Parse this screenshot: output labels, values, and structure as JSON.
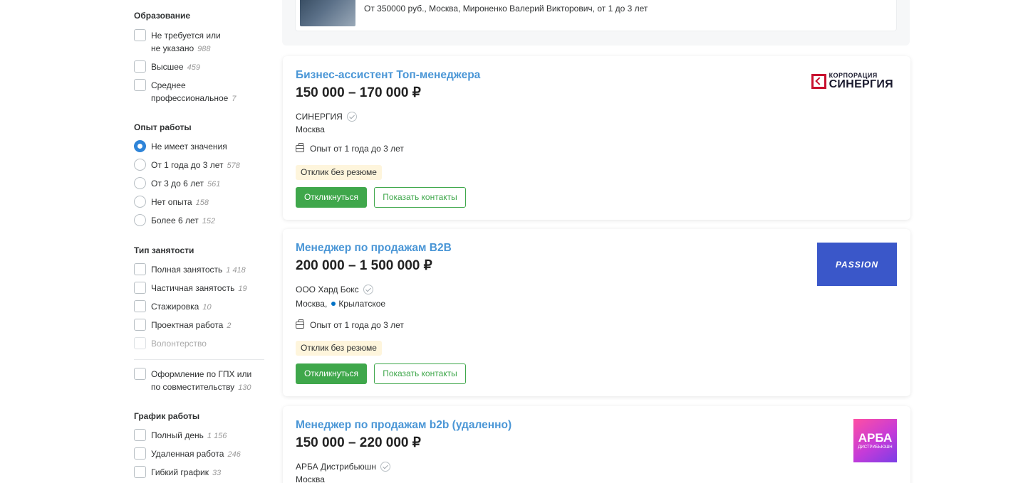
{
  "filters": {
    "education": {
      "title": "Образование",
      "options": [
        {
          "label_line1": "Не требуется или",
          "label_line2": "не указано",
          "count": "988"
        },
        {
          "label": "Высшее",
          "count": "459"
        },
        {
          "label_line1": "Среднее",
          "label_line2": "профессиональное",
          "count": "7"
        }
      ]
    },
    "experience": {
      "title": "Опыт работы",
      "options": [
        {
          "label": "Не имеет значения",
          "count": "",
          "selected": true
        },
        {
          "label": "От 1 года до 3 лет",
          "count": "578"
        },
        {
          "label": "От 3 до 6 лет",
          "count": "561"
        },
        {
          "label": "Нет опыта",
          "count": "158"
        },
        {
          "label": "Более 6 лет",
          "count": "152"
        }
      ]
    },
    "employment": {
      "title": "Тип занятости",
      "options": [
        {
          "label": "Полная занятость",
          "count": "1 418"
        },
        {
          "label": "Частичная занятость",
          "count": "19"
        },
        {
          "label": "Стажировка",
          "count": "10"
        },
        {
          "label": "Проектная работа",
          "count": "2"
        },
        {
          "label": "Волонтерство",
          "count": "",
          "disabled": true
        }
      ],
      "extra": {
        "label_line1": "Оформление по ГПХ или",
        "label_line2": "по совместительству",
        "count": "130"
      }
    },
    "schedule": {
      "title": "График работы",
      "options": [
        {
          "label": "Полный день",
          "count": "1 156"
        },
        {
          "label": "Удаленная работа",
          "count": "246"
        },
        {
          "label": "Гибкий график",
          "count": "33"
        }
      ]
    }
  },
  "top_card": {
    "text": "От 350000 руб., Москва, Мироненко Валерий Викторович, от 1 до 3 лет"
  },
  "vacancies": [
    {
      "title": "Бизнес-ассистент Топ-менеджера",
      "salary": "150 000 – 170 000 ₽",
      "company": "СИНЕРГИЯ",
      "city": "Москва",
      "metro": "",
      "experience": "Опыт от 1 года до 3 лет",
      "badge": "Отклик без резюме",
      "apply_label": "Откликнуться",
      "contacts_label": "Показать контакты",
      "logo": {
        "small": "КОРПОРАЦИЯ",
        "big": "СИНЕРГИЯ",
        "color": "#c8102e"
      }
    },
    {
      "title": "Менеджер по продажам B2B",
      "salary": "200 000 – 1 500 000 ₽",
      "company": "ООО Хард Бокс",
      "city": "Москва,",
      "metro": "Крылатское",
      "experience": "Опыт от 1 года до 3 лет",
      "badge": "Отклик без резюме",
      "apply_label": "Откликнуться",
      "contacts_label": "Показать контакты",
      "logo": {
        "text": "PASSION",
        "color": "#3a57c9"
      }
    },
    {
      "title": "Менеджер по продажам b2b (удаленно)",
      "salary": "150 000 – 220 000 ₽",
      "company": "АРБА Дистрибьюшн",
      "city": "Москва",
      "logo": {
        "big": "АРБА",
        "small": "ДИСТРИБЬЮШН"
      }
    }
  ],
  "colors": {
    "link": "#4a96d6",
    "accent_green": "#3fa74b",
    "badge_bg": "#fef5dc",
    "radio_selected": "#2e84d8"
  },
  "icons": [
    "check-circle-icon",
    "briefcase-icon",
    "metro-dot-icon"
  ]
}
